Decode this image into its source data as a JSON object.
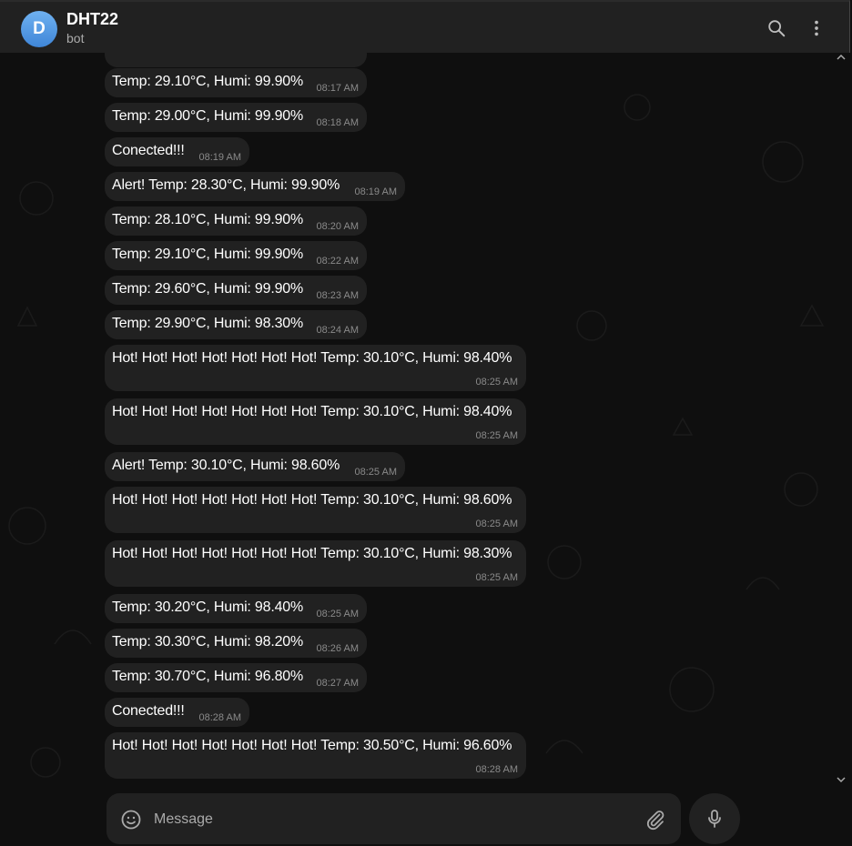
{
  "header": {
    "avatar_letter": "D",
    "title": "DHT22",
    "subtitle": "bot",
    "icons": [
      "search-icon",
      "more-vertical-icon"
    ]
  },
  "messages": [
    {
      "text": "Temp: 29.10°C, Humi: 99.90%",
      "time": "08:17 AM"
    },
    {
      "text": "Temp: 29.00°C, Humi: 99.90%",
      "time": "08:18 AM"
    },
    {
      "text": "Conected!!!",
      "time": "08:19 AM"
    },
    {
      "text": "Alert! Temp: 28.30°C, Humi: 99.90%",
      "time": "08:19 AM"
    },
    {
      "text": "Temp: 28.10°C, Humi: 99.90%",
      "time": "08:20 AM"
    },
    {
      "text": "Temp: 29.10°C, Humi: 99.90%",
      "time": "08:22 AM"
    },
    {
      "text": "Temp: 29.60°C, Humi: 99.90%",
      "time": "08:23 AM"
    },
    {
      "text": "Temp: 29.90°C, Humi: 98.30%",
      "time": "08:24 AM"
    },
    {
      "text": "Hot! Hot! Hot! Hot! Hot! Hot! Hot! Temp: 30.10°C, Humi: 98.40%",
      "time": "08:25 AM"
    },
    {
      "text": "Hot! Hot! Hot! Hot! Hot! Hot! Hot! Temp: 30.10°C, Humi: 98.40%",
      "time": "08:25 AM"
    },
    {
      "text": "Alert! Temp: 30.10°C, Humi: 98.60%",
      "time": "08:25 AM"
    },
    {
      "text": "Hot! Hot! Hot! Hot! Hot! Hot! Hot! Temp: 30.10°C, Humi: 98.60%",
      "time": "08:25 AM"
    },
    {
      "text": "Hot! Hot! Hot! Hot! Hot! Hot! Hot! Temp: 30.10°C, Humi: 98.30%",
      "time": "08:25 AM"
    },
    {
      "text": "Temp: 30.20°C, Humi: 98.40%",
      "time": "08:25 AM"
    },
    {
      "text": "Temp: 30.30°C, Humi: 98.20%",
      "time": "08:26 AM"
    },
    {
      "text": "Temp: 30.70°C, Humi: 96.80%",
      "time": "08:27 AM"
    },
    {
      "text": "Conected!!!",
      "time": "08:28 AM"
    },
    {
      "text": "Hot! Hot! Hot! Hot! Hot! Hot! Hot! Temp: 30.50°C, Humi: 96.60%",
      "time": "08:28 AM"
    }
  ],
  "composer": {
    "placeholder": "Message",
    "icons": [
      "emoji-icon",
      "paperclip-icon",
      "microphone-icon"
    ]
  },
  "colors": {
    "background": "#0f0f0f",
    "bubble": "#212121",
    "header": "#212121",
    "avatar": "#4a90e2"
  }
}
